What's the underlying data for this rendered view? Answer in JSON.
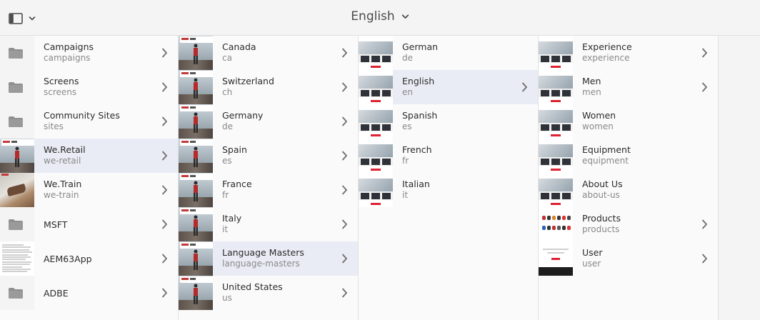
{
  "header": {
    "title": "English",
    "rail_icon": "rail-toggle-icon",
    "title_icon": "chevron-down-icon"
  },
  "columns": [
    {
      "items": [
        {
          "label": "Campaigns",
          "sub": "campaigns",
          "thumb": "folder",
          "has_children": true
        },
        {
          "label": "Screens",
          "sub": "screens",
          "thumb": "folder",
          "has_children": true
        },
        {
          "label": "Community Sites",
          "sub": "sites",
          "thumb": "folder",
          "has_children": true
        },
        {
          "label": "We.Retail",
          "sub": "we-retail",
          "thumb": "photo",
          "has_children": true,
          "selected": true
        },
        {
          "label": "We.Train",
          "sub": "we-train",
          "thumb": "train",
          "has_children": true
        },
        {
          "label": "MSFT",
          "sub": "",
          "thumb": "folder",
          "has_children": true
        },
        {
          "label": "AEM63App",
          "sub": "",
          "thumb": "doc",
          "has_children": true
        },
        {
          "label": "ADBE",
          "sub": "",
          "thumb": "folder",
          "has_children": true
        }
      ]
    },
    {
      "items": [
        {
          "label": "Canada",
          "sub": "ca",
          "thumb": "photo",
          "has_children": true
        },
        {
          "label": "Switzerland",
          "sub": "ch",
          "thumb": "photo",
          "has_children": true
        },
        {
          "label": "Germany",
          "sub": "de",
          "thumb": "photo",
          "has_children": true
        },
        {
          "label": "Spain",
          "sub": "es",
          "thumb": "photo",
          "has_children": true
        },
        {
          "label": "France",
          "sub": "fr",
          "thumb": "photo",
          "has_children": true
        },
        {
          "label": "Italy",
          "sub": "it",
          "thumb": "photo",
          "has_children": true
        },
        {
          "label": "Language Masters",
          "sub": "language-masters",
          "thumb": "photo",
          "has_children": true,
          "selected": true
        },
        {
          "label": "United States",
          "sub": "us",
          "thumb": "photo",
          "has_children": true
        }
      ]
    },
    {
      "items": [
        {
          "label": "German",
          "sub": "de",
          "thumb": "page",
          "has_children": false
        },
        {
          "label": "English",
          "sub": "en",
          "thumb": "page",
          "has_children": true,
          "selected": true
        },
        {
          "label": "Spanish",
          "sub": "es",
          "thumb": "page",
          "has_children": false
        },
        {
          "label": "French",
          "sub": "fr",
          "thumb": "page",
          "has_children": false
        },
        {
          "label": "Italian",
          "sub": "it",
          "thumb": "page",
          "has_children": false
        }
      ]
    },
    {
      "items": [
        {
          "label": "Experience",
          "sub": "experience",
          "thumb": "page",
          "has_children": true
        },
        {
          "label": "Men",
          "sub": "men",
          "thumb": "page",
          "has_children": true
        },
        {
          "label": "Women",
          "sub": "women",
          "thumb": "page",
          "has_children": false
        },
        {
          "label": "Equipment",
          "sub": "equipment",
          "thumb": "page",
          "has_children": false
        },
        {
          "label": "About Us",
          "sub": "about-us",
          "thumb": "page",
          "has_children": false
        },
        {
          "label": "Products",
          "sub": "products",
          "thumb": "products",
          "has_children": true
        },
        {
          "label": "User",
          "sub": "user",
          "thumb": "user",
          "has_children": true
        }
      ]
    }
  ],
  "colors": {
    "selected_row": "#e9ecf4",
    "background": "#f4f4f4",
    "brand_red": "#d22233"
  }
}
